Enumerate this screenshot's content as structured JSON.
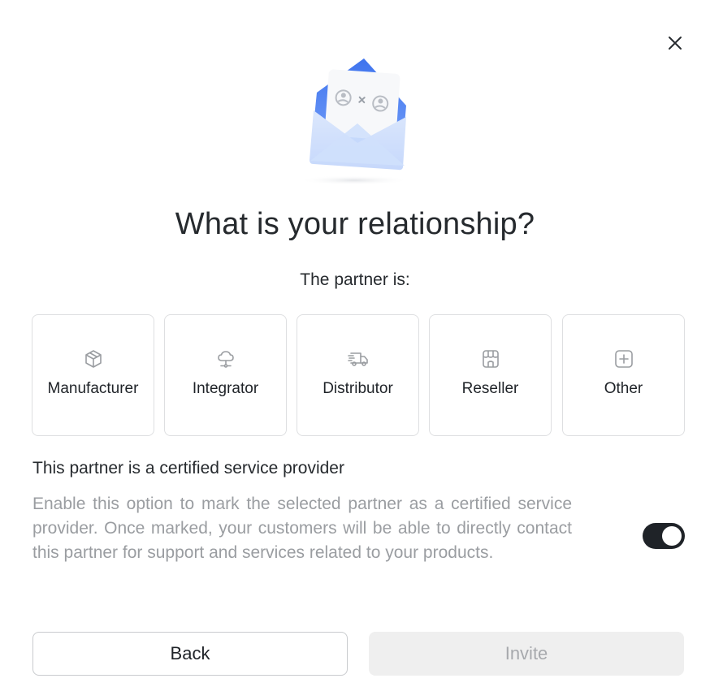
{
  "dialog": {
    "title": "What is your relationship?",
    "subtitle": "The partner is:",
    "close_icon": "close-icon"
  },
  "options": [
    {
      "label": "Manufacturer",
      "icon": "box-icon"
    },
    {
      "label": "Integrator",
      "icon": "cloud-network-icon"
    },
    {
      "label": "Distributor",
      "icon": "delivery-truck-icon"
    },
    {
      "label": "Reseller",
      "icon": "storefront-icon"
    },
    {
      "label": "Other",
      "icon": "plus-square-icon"
    }
  ],
  "certified": {
    "title": "This partner is a certified service provider",
    "description": "Enable this option to mark the selected partner as a certified service provider. Once marked, your customers will be able to directly contact this partner for support and services related to your products.",
    "enabled": true
  },
  "buttons": {
    "back_label": "Back",
    "invite_label": "Invite"
  },
  "colors": {
    "accent_blue": "#4c7ef3",
    "toggle_on": "#1f2328",
    "muted_text": "#9a9da1",
    "disabled_button_bg": "#efefef"
  }
}
